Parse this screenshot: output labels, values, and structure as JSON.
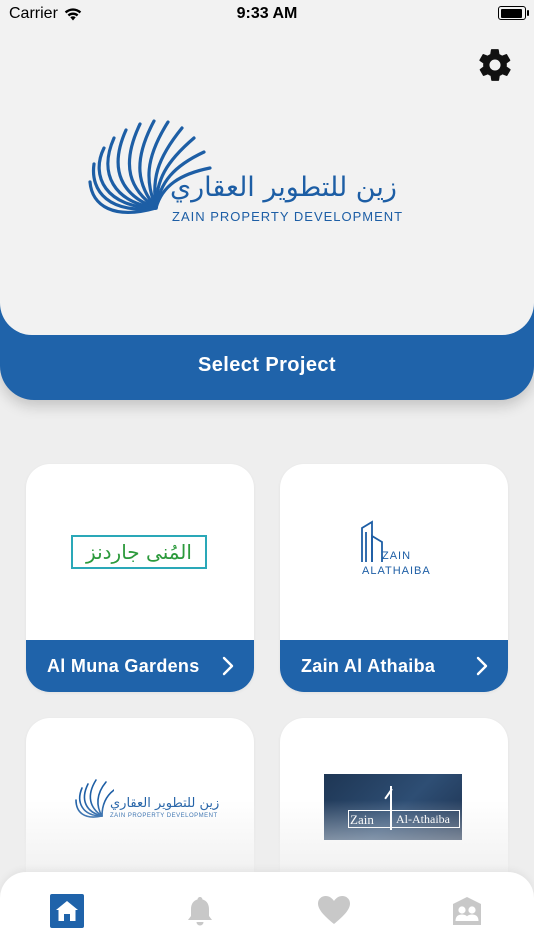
{
  "status_bar": {
    "carrier": "Carrier",
    "time": "9:33 AM"
  },
  "header": {
    "logo_arabic": "زين للتطوير العقاري",
    "logo_english": "ZAIN PROPERTY DEVELOPMENT",
    "select_project": "Select Project"
  },
  "projects": [
    {
      "label": "Al Muna Gardens",
      "logo_text": "المُنى جاردنز"
    },
    {
      "label": "Zain Al Athaiba",
      "logo_text_1": "ZAIN",
      "logo_text_2": "ALATHAIBA"
    },
    {
      "label": "",
      "logo_arabic": "زين للتطوير العقاري",
      "logo_english": "ZAIN PROPERTY DEVELOPMENT"
    },
    {
      "label": "",
      "logo_text_1": "Zain",
      "logo_text_2": "Al-Athaiba"
    }
  ],
  "tab_bar": {
    "items": [
      {
        "icon": "home-icon",
        "active": true
      },
      {
        "icon": "bell-icon",
        "active": false
      },
      {
        "icon": "heart-icon",
        "active": false
      },
      {
        "icon": "contacts-icon",
        "active": false
      }
    ]
  },
  "colors": {
    "primary": "#1f63aa",
    "inactive_icon": "#c8c8c8"
  }
}
